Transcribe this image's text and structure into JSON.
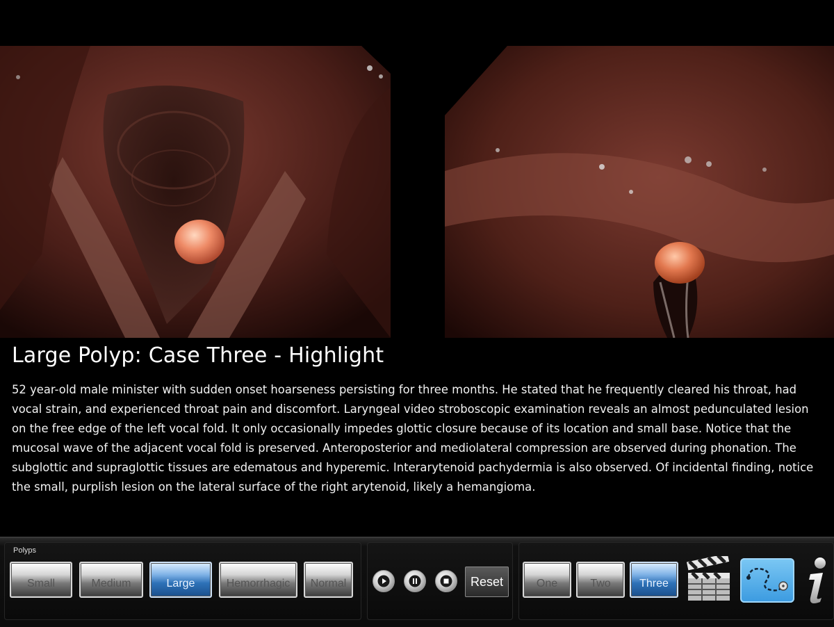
{
  "case": {
    "title": "Large Polyp: Case Three - Highlight",
    "description": "52 year-old male minister with sudden onset hoarseness persisting for three months. He stated that he frequently cleared his throat, had vocal strain, and experienced throat pain and discomfort. Laryngeal video stroboscopic examination reveals an almost pedunculated lesion on the free edge of the left vocal fold. It only occasionally impedes glottic closure because of its location and small base. Notice that the mucosal wave of the adjacent vocal fold is preserved. Anteroposterior and mediolateral compression are observed during phonation. The subglottic and supraglottic tissues are edematous and hyperemic. Interarytenoid pachydermia is also observed. Of incidental finding, notice the small, purplish lesion on the lateral surface of the right arytenoid, likely a hemangioma."
  },
  "toolbar": {
    "polyps": {
      "label": "Polyps",
      "buttons": [
        {
          "label": "Small",
          "active": false
        },
        {
          "label": "Medium",
          "active": false
        },
        {
          "label": "Large",
          "active": true
        },
        {
          "label": "Hemorrhagic",
          "active": false
        },
        {
          "label": "Normal",
          "active": false
        }
      ]
    },
    "media": {
      "icons": [
        "play-icon",
        "pause-icon",
        "stop-icon"
      ],
      "reset_label": "Reset"
    },
    "cases": {
      "buttons": [
        {
          "label": "One",
          "active": false
        },
        {
          "label": "Two",
          "active": false
        },
        {
          "label": "Three",
          "active": true
        }
      ]
    },
    "icons": [
      "clapperboard-icon",
      "path-trace-icon",
      "info-icon"
    ]
  },
  "colors": {
    "active_button": "#2e72b8",
    "background": "#000000",
    "tissue": "#5a2a22",
    "polyp": "#e88a68"
  }
}
